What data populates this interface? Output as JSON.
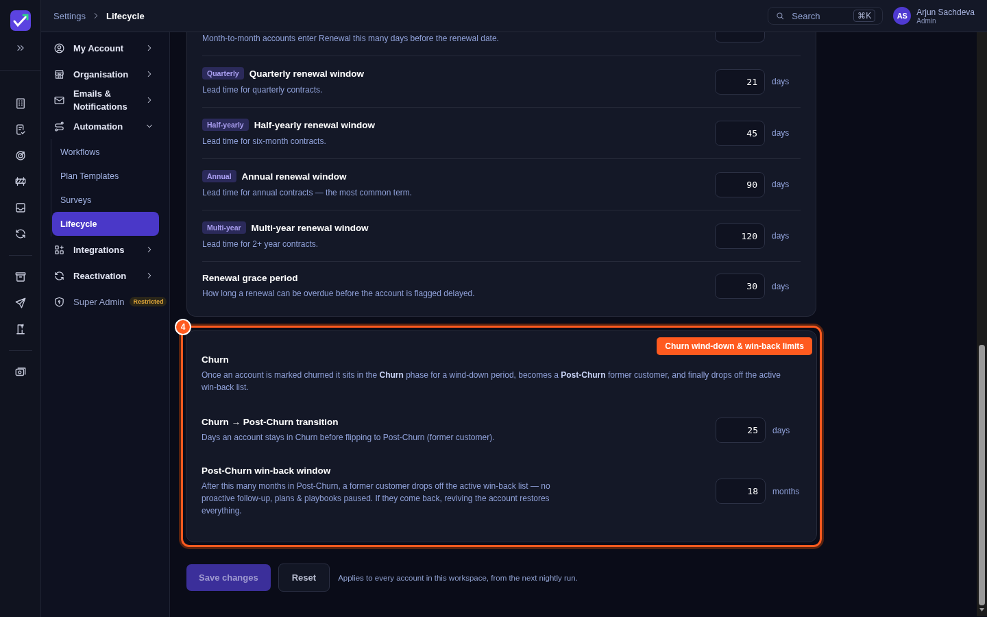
{
  "header": {
    "breadcrumb": [
      "Settings",
      "Lifecycle"
    ],
    "search": {
      "placeholder": "Search",
      "shortcut": "⌘K"
    },
    "user": {
      "initials": "AS",
      "name": "Arjun Sachdeva",
      "role": "Admin"
    }
  },
  "nav": [
    {
      "label": "My Account",
      "kind": "link"
    },
    {
      "label": "Organisation",
      "kind": "link"
    },
    {
      "label": "Emails & Notifications",
      "kind": "link"
    },
    {
      "label": "Automation",
      "kind": "group",
      "expanded": true,
      "children": [
        {
          "label": "Workflows",
          "selected": false
        },
        {
          "label": "Plan Templates",
          "selected": false
        },
        {
          "label": "Surveys",
          "selected": false
        },
        {
          "label": "Lifecycle",
          "selected": true
        }
      ]
    },
    {
      "label": "Integrations",
      "kind": "link"
    },
    {
      "label": "Reactivation",
      "kind": "link"
    },
    {
      "label": "Super Admin",
      "kind": "restricted",
      "badge": "Restricted"
    }
  ],
  "renewal_rows": [
    {
      "kind": "partial",
      "description": "Month-to-month accounts enter Renewal this many days before the renewal date."
    },
    {
      "kind": "row",
      "tag": "Quarterly",
      "title": "Quarterly renewal window",
      "description": "Lead time for quarterly contracts.",
      "value": "21",
      "unit": "days"
    },
    {
      "kind": "row",
      "tag": "Half-yearly",
      "title": "Half-yearly renewal window",
      "description": "Lead time for six-month contracts.",
      "value": "45",
      "unit": "days"
    },
    {
      "kind": "row",
      "tag": "Annual",
      "title": "Annual renewal window",
      "description": "Lead time for annual contracts — the most common term.",
      "value": "90",
      "unit": "days"
    },
    {
      "kind": "row",
      "tag": "Multi-year",
      "title": "Multi-year renewal window",
      "description": "Lead time for 2+ year contracts.",
      "value": "120",
      "unit": "days"
    },
    {
      "kind": "row",
      "title": "Renewal grace period",
      "description": "How long a renewal can be overdue before the account is flagged delayed.",
      "value": "30",
      "unit": "days"
    }
  ],
  "churn": {
    "step": "4",
    "title": "Churn",
    "callout": "Churn wind-down & win-back limits",
    "description": "Once an account is marked churned it sits in the **Churn** phase for a wind-down period, becomes a **Post-Churn** former customer, and finally drops off the active win-back list.",
    "rows": [
      {
        "title": "Churn → Post-Churn transition",
        "description": "Days an account stays in Churn before flipping to Post-Churn (former customer).",
        "value": "25",
        "unit": "days"
      },
      {
        "title": "Post-Churn win-back window",
        "description": "After this many months in Post-Churn, a former customer drops off the active win-back list — no proactive follow-up, plans & playbooks paused. If they come back, reviving the account restores everything.",
        "value": "18",
        "unit": "months"
      }
    ]
  },
  "footer": {
    "save": {
      "label": "Save changes",
      "disabled": true
    },
    "reset": "Reset",
    "note": "Applies to every account in this workspace, from the next nightly run."
  }
}
